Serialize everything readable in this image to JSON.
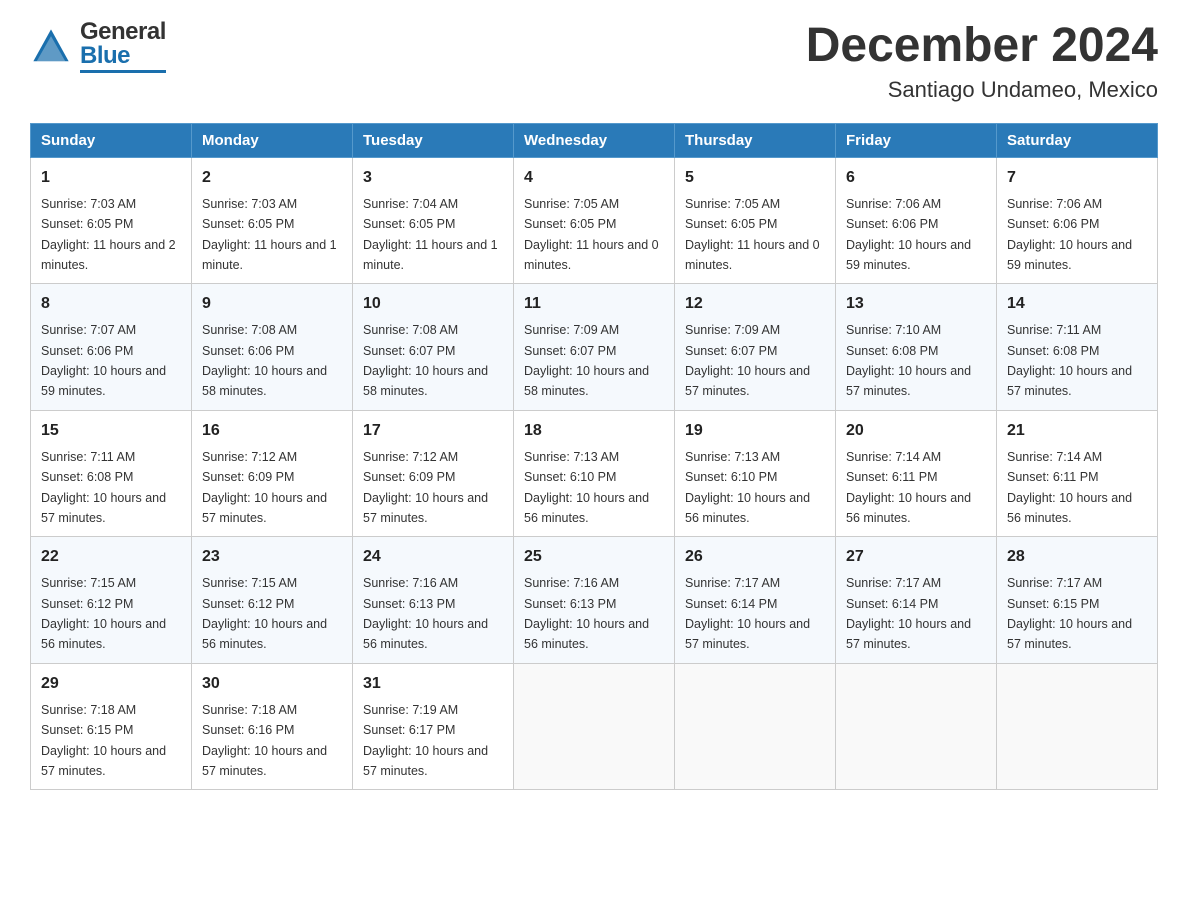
{
  "header": {
    "logo_general": "General",
    "logo_blue": "Blue",
    "title": "December 2024",
    "subtitle": "Santiago Undameo, Mexico"
  },
  "columns": [
    "Sunday",
    "Monday",
    "Tuesday",
    "Wednesday",
    "Thursday",
    "Friday",
    "Saturday"
  ],
  "weeks": [
    [
      {
        "day": "1",
        "sunrise": "7:03 AM",
        "sunset": "6:05 PM",
        "daylight": "11 hours and 2 minutes."
      },
      {
        "day": "2",
        "sunrise": "7:03 AM",
        "sunset": "6:05 PM",
        "daylight": "11 hours and 1 minute."
      },
      {
        "day": "3",
        "sunrise": "7:04 AM",
        "sunset": "6:05 PM",
        "daylight": "11 hours and 1 minute."
      },
      {
        "day": "4",
        "sunrise": "7:05 AM",
        "sunset": "6:05 PM",
        "daylight": "11 hours and 0 minutes."
      },
      {
        "day": "5",
        "sunrise": "7:05 AM",
        "sunset": "6:05 PM",
        "daylight": "11 hours and 0 minutes."
      },
      {
        "day": "6",
        "sunrise": "7:06 AM",
        "sunset": "6:06 PM",
        "daylight": "10 hours and 59 minutes."
      },
      {
        "day": "7",
        "sunrise": "7:06 AM",
        "sunset": "6:06 PM",
        "daylight": "10 hours and 59 minutes."
      }
    ],
    [
      {
        "day": "8",
        "sunrise": "7:07 AM",
        "sunset": "6:06 PM",
        "daylight": "10 hours and 59 minutes."
      },
      {
        "day": "9",
        "sunrise": "7:08 AM",
        "sunset": "6:06 PM",
        "daylight": "10 hours and 58 minutes."
      },
      {
        "day": "10",
        "sunrise": "7:08 AM",
        "sunset": "6:07 PM",
        "daylight": "10 hours and 58 minutes."
      },
      {
        "day": "11",
        "sunrise": "7:09 AM",
        "sunset": "6:07 PM",
        "daylight": "10 hours and 58 minutes."
      },
      {
        "day": "12",
        "sunrise": "7:09 AM",
        "sunset": "6:07 PM",
        "daylight": "10 hours and 57 minutes."
      },
      {
        "day": "13",
        "sunrise": "7:10 AM",
        "sunset": "6:08 PM",
        "daylight": "10 hours and 57 minutes."
      },
      {
        "day": "14",
        "sunrise": "7:11 AM",
        "sunset": "6:08 PM",
        "daylight": "10 hours and 57 minutes."
      }
    ],
    [
      {
        "day": "15",
        "sunrise": "7:11 AM",
        "sunset": "6:08 PM",
        "daylight": "10 hours and 57 minutes."
      },
      {
        "day": "16",
        "sunrise": "7:12 AM",
        "sunset": "6:09 PM",
        "daylight": "10 hours and 57 minutes."
      },
      {
        "day": "17",
        "sunrise": "7:12 AM",
        "sunset": "6:09 PM",
        "daylight": "10 hours and 57 minutes."
      },
      {
        "day": "18",
        "sunrise": "7:13 AM",
        "sunset": "6:10 PM",
        "daylight": "10 hours and 56 minutes."
      },
      {
        "day": "19",
        "sunrise": "7:13 AM",
        "sunset": "6:10 PM",
        "daylight": "10 hours and 56 minutes."
      },
      {
        "day": "20",
        "sunrise": "7:14 AM",
        "sunset": "6:11 PM",
        "daylight": "10 hours and 56 minutes."
      },
      {
        "day": "21",
        "sunrise": "7:14 AM",
        "sunset": "6:11 PM",
        "daylight": "10 hours and 56 minutes."
      }
    ],
    [
      {
        "day": "22",
        "sunrise": "7:15 AM",
        "sunset": "6:12 PM",
        "daylight": "10 hours and 56 minutes."
      },
      {
        "day": "23",
        "sunrise": "7:15 AM",
        "sunset": "6:12 PM",
        "daylight": "10 hours and 56 minutes."
      },
      {
        "day": "24",
        "sunrise": "7:16 AM",
        "sunset": "6:13 PM",
        "daylight": "10 hours and 56 minutes."
      },
      {
        "day": "25",
        "sunrise": "7:16 AM",
        "sunset": "6:13 PM",
        "daylight": "10 hours and 56 minutes."
      },
      {
        "day": "26",
        "sunrise": "7:17 AM",
        "sunset": "6:14 PM",
        "daylight": "10 hours and 57 minutes."
      },
      {
        "day": "27",
        "sunrise": "7:17 AM",
        "sunset": "6:14 PM",
        "daylight": "10 hours and 57 minutes."
      },
      {
        "day": "28",
        "sunrise": "7:17 AM",
        "sunset": "6:15 PM",
        "daylight": "10 hours and 57 minutes."
      }
    ],
    [
      {
        "day": "29",
        "sunrise": "7:18 AM",
        "sunset": "6:15 PM",
        "daylight": "10 hours and 57 minutes."
      },
      {
        "day": "30",
        "sunrise": "7:18 AM",
        "sunset": "6:16 PM",
        "daylight": "10 hours and 57 minutes."
      },
      {
        "day": "31",
        "sunrise": "7:19 AM",
        "sunset": "6:17 PM",
        "daylight": "10 hours and 57 minutes."
      },
      null,
      null,
      null,
      null
    ]
  ],
  "labels": {
    "sunrise": "Sunrise:",
    "sunset": "Sunset:",
    "daylight": "Daylight:"
  }
}
